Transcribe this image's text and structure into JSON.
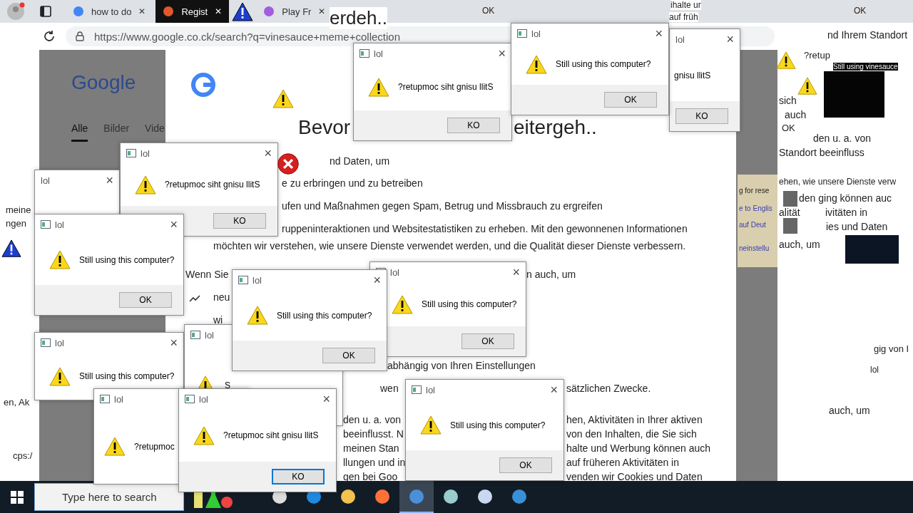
{
  "browser": {
    "tabs": [
      {
        "label": "how to do",
        "close": "✕",
        "selected": false
      },
      {
        "label": "Regist",
        "close": "✕",
        "selected": true
      },
      {
        "label": "Play Fr",
        "close": "✕",
        "selected": false
      }
    ],
    "url": "https://www.google.co.ck/search?q=vinesauce+meme+collection"
  },
  "results_page": {
    "logo": "Google",
    "nav": [
      {
        "label": "Alle",
        "selected": true
      },
      {
        "label": "Bilder",
        "selected": false
      },
      {
        "label": "Vide",
        "selected": false
      }
    ]
  },
  "consent": {
    "heading": [
      "Bevor",
      "eitergeh.."
    ],
    "lines": [
      "nd Daten, um",
      "e zu erbringen und zu betreiben",
      "ufen und Maßnahmen gegen Spam, Betrug und Missbrauch zu ergreifen",
      "ruppeninteraktionen und Websitestatistiken zu erheben. Mit den gewonnenen Informationen",
      "möchten wir verstehen, wie unsere Dienste verwendet werden, und die Qualität dieser Dienste verbessern.",
      "Wenn Sie",
      "n auch, um",
      "neu",
      "wi",
      "abhängig von Ihren Einstellungen",
      "wen",
      "sätzlichen Zwecke.",
      "den u. a. von",
      "hen, Aktivitäten in Ihrer aktiven",
      "beeinflusst. N",
      "von den Inhalten, die Sie sich",
      "meinen Stan",
      "halte und Werbung können auch",
      "llungen und in",
      "auf früheren Aktivitäten in",
      "gen bei Goo",
      "venden wir Cookies und Daten"
    ]
  },
  "side_panel": [
    "g for rese",
    "e to Englis",
    "auf Deut",
    "neinstellu"
  ],
  "glitch_texts": [
    "ihalte ur",
    "OK",
    "OK",
    "erdeh..",
    "auf früh",
    "nd Ihrem Standort",
    "?retup",
    "Still using vinesauce",
    "sich",
    "auch",
    "OK",
    "den u. a. von",
    "Standort beeinfluss",
    "ehen, wie unsere Dienste verw",
    "den ging können auc",
    "meine",
    "alität",
    "ivitäten in",
    "ngen",
    "ies und Daten",
    "auch, um",
    "gig von I",
    "lol",
    "en, Ak",
    "auch, um",
    "cps:/"
  ],
  "dialogs": [
    {
      "kind": "fragment",
      "title": "lol",
      "close": "×",
      "message": "gnisu llitS",
      "button": "KO",
      "focused": false
    },
    {
      "kind": "alert",
      "title": "lol",
      "close": "×",
      "message": "?retupmoc siht gnisu llitS",
      "button": "KO",
      "focused": false
    },
    {
      "kind": "alert",
      "title": "lol",
      "close": "×",
      "message": "Still using this computer?",
      "button": "OK",
      "focused": false
    },
    {
      "kind": "fragment",
      "title": "lol",
      "close": "×"
    },
    {
      "kind": "alert",
      "title": "lol",
      "close": "×",
      "message": "?retupmoc siht gnisu llitS",
      "button": "KO",
      "focused": false
    },
    {
      "kind": "alert",
      "title": "lol",
      "close": "×",
      "message": "Still using this computer?",
      "button": "OK",
      "focused": false
    },
    {
      "kind": "alert",
      "title": "lol",
      "close": "×",
      "message": "Still using this computer?"
    },
    {
      "kind": "alert",
      "title": "lol",
      "message": "S"
    },
    {
      "kind": "alert",
      "title": "lol",
      "close": "×",
      "message": "Still using this computer?",
      "button": "OK",
      "focused": false
    },
    {
      "kind": "alert",
      "title": "lol",
      "close": "×",
      "message": "Still using this computer?",
      "button": "OK",
      "focused": false
    },
    {
      "kind": "alert",
      "title": "lol",
      "message": "?retupmoc"
    },
    {
      "kind": "alert",
      "title": "lol",
      "close": "×",
      "message": "?retupmoc siht gnisu llitS",
      "button": "KO",
      "focused": true
    },
    {
      "kind": "alert",
      "title": "lol",
      "close": "×",
      "message": "Still using this computer?",
      "button": "OK",
      "focused": false
    }
  ],
  "taskbar": {
    "search": {
      "placeholder": "Type here to search"
    },
    "apps": [
      {
        "selected": false
      },
      {
        "selected": false
      },
      {
        "selected": false
      },
      {
        "selected": false
      },
      {
        "selected": true
      },
      {
        "selected": false
      },
      {
        "selected": false
      },
      {
        "selected": false
      }
    ]
  }
}
